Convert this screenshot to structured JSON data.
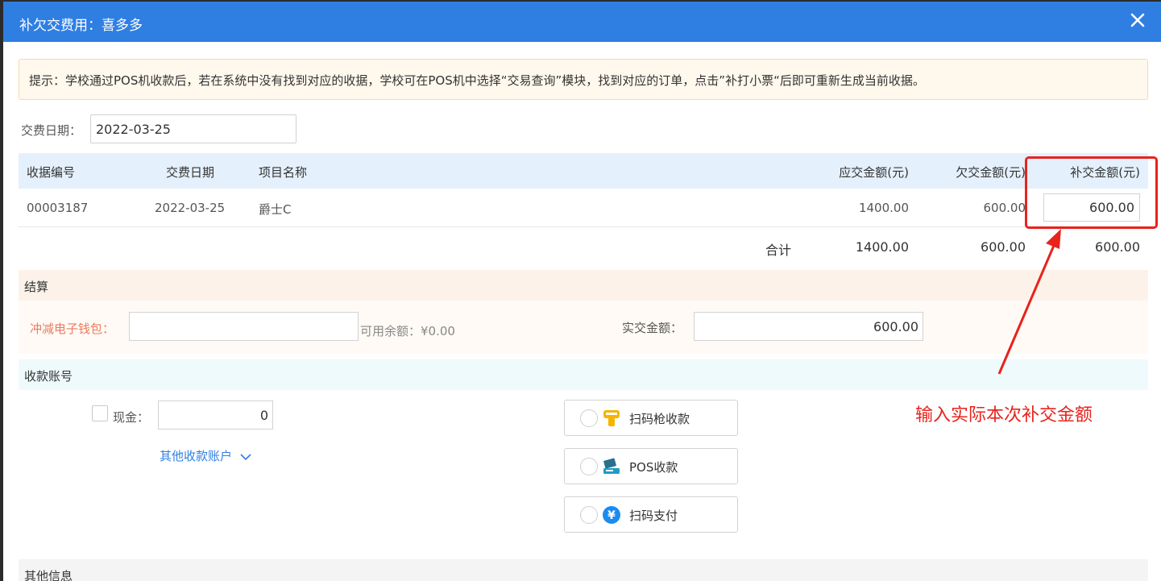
{
  "dialog": {
    "title": "补欠交费用：喜多多",
    "close_icon": "close-icon"
  },
  "tip": "提示：学校通过POS机收款后，若在系统中没有找到对应的收据，学校可在POS机中选择“交易查询”模块，找到对应的订单，点击”补打小票“后即可重新生成当前收据。",
  "pay_date": {
    "label": "交费日期：",
    "value": "2022-03-25"
  },
  "table": {
    "headers": [
      "收据编号",
      "交费日期",
      "项目名称",
      "应交金额(元)",
      "欠交金额(元)",
      "补交金额(元)"
    ],
    "rows": [
      {
        "receipt_no": "00003187",
        "date": "2022-03-25",
        "item": "爵士C",
        "due": "1400.00",
        "owed": "600.00",
        "pay": "600.00"
      }
    ],
    "total": {
      "label": "合计",
      "due": "1400.00",
      "owed": "600.00",
      "pay": "600.00"
    }
  },
  "settlement": {
    "section_title": "结算",
    "wallet_label": "冲减电子钱包：",
    "wallet_value": "",
    "balance_text": "可用余额：¥0.00",
    "actual_label": "实交金额：",
    "actual_value": "600.00"
  },
  "account": {
    "section_title": "收款账号",
    "cash_label": "现金：",
    "cash_value": "0",
    "cash_checked": false,
    "other_accounts_link": "其他收款账户",
    "pay_options": [
      {
        "label": "扫码枪收款",
        "icon": "scanner-gun-icon"
      },
      {
        "label": "POS收款",
        "icon": "pos-terminal-icon"
      },
      {
        "label": "扫码支付",
        "icon": "yuan-pay-icon"
      }
    ]
  },
  "other_info": {
    "section_title": "其他信息"
  },
  "annotation": {
    "text": "输入实际本次补交金额",
    "color": "#e8231c"
  },
  "colors": {
    "titlebar": "#2f7fe3",
    "link": "#2f7fe3",
    "wallet_label": "#ec7a5c",
    "annotation": "#e8231c"
  }
}
